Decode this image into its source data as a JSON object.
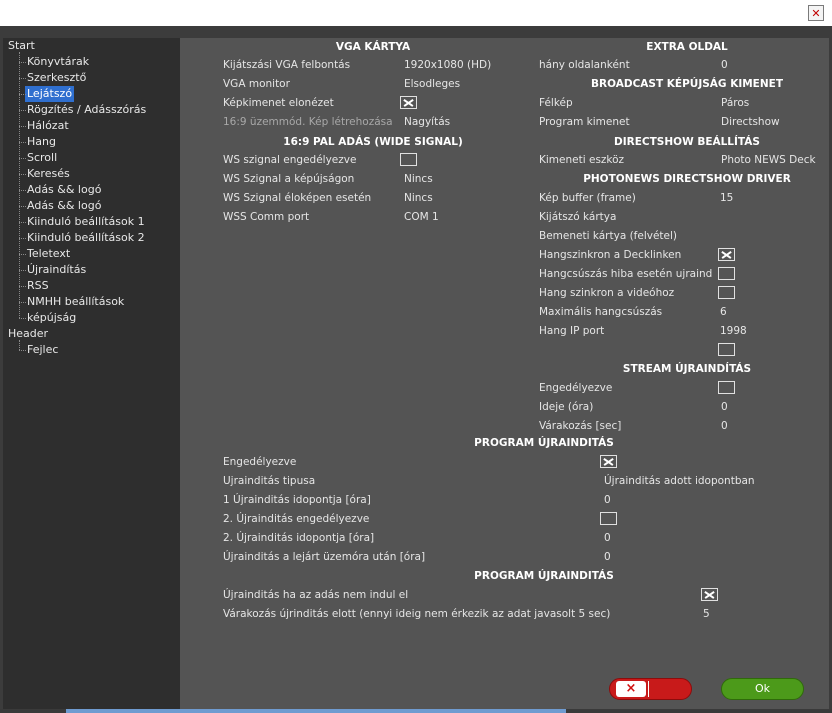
{
  "window": {
    "close_icon": "close-icon"
  },
  "tree": [
    {
      "label": "Start",
      "level": 0
    },
    {
      "label": "Könyvtárak",
      "level": 1
    },
    {
      "label": "Szerkesztő",
      "level": 1
    },
    {
      "label": "Lejátszó",
      "level": 1,
      "selected": true
    },
    {
      "label": "Rögzítés / Adásszórás",
      "level": 1
    },
    {
      "label": "Hálózat",
      "level": 1
    },
    {
      "label": "Hang",
      "level": 1
    },
    {
      "label": "Scroll",
      "level": 1
    },
    {
      "label": "Keresés",
      "level": 1
    },
    {
      "label": "Adás && logó",
      "level": 1
    },
    {
      "label": "Adás && logó",
      "level": 1
    },
    {
      "label": "Kiinduló beállítások 1",
      "level": 1
    },
    {
      "label": "Kiinduló beállítások 2",
      "level": 1
    },
    {
      "label": "Teletext",
      "level": 1
    },
    {
      "label": "Újraindítás",
      "level": 1
    },
    {
      "label": "RSS",
      "level": 1
    },
    {
      "label": "NMHH beállítások",
      "level": 1
    },
    {
      "label": "képújság",
      "level": 1
    },
    {
      "label": "Header",
      "level": 0
    },
    {
      "label": "Fejlec",
      "level": 1
    }
  ],
  "vga": {
    "header": "VGA KÁRTYA",
    "rows": [
      {
        "label": "Kijátszási VGA felbontás",
        "value": "1920x1080 (HD)"
      },
      {
        "label": "VGA monitor",
        "value": "Elsodleges"
      },
      {
        "label": "Képkimenet elonézet",
        "checked": true
      },
      {
        "label": "16:9 üzemmód. Kép létrehozása",
        "value": "Nagyítás",
        "dim": true
      }
    ]
  },
  "pal": {
    "header": "16:9 PAL ADÁS (WIDE SIGNAL)",
    "rows": [
      {
        "label": "WS szignal engedélyezve",
        "checked": false
      },
      {
        "label": "WS Szignal a képújságon",
        "value": "Nincs"
      },
      {
        "label": "WS Szignal éloképen esetén",
        "value": "Nincs"
      },
      {
        "label": "WSS Comm port",
        "value": "COM 1"
      }
    ]
  },
  "extra": {
    "header": "EXTRA OLDAL",
    "rows": [
      {
        "label": "hány oldalanként",
        "value": "0"
      }
    ]
  },
  "broadcast": {
    "header": "BROADCAST KÉPÚJSÁG KIMENET",
    "rows": [
      {
        "label": "Félkép",
        "value": "Páros"
      },
      {
        "label": "Program kimenet",
        "value": "Directshow"
      }
    ]
  },
  "directshow": {
    "header": "DIRECTSHOW BEÁLLÍTÁS",
    "rows": [
      {
        "label": "Kimeneti eszköz",
        "value": "Photo NEWS Deck"
      }
    ]
  },
  "photonews": {
    "header": "PHOTONEWS DIRECTSHOW DRIVER",
    "rows": [
      {
        "label": "Kép buffer (frame)",
        "value": "15"
      },
      {
        "label": "Kijátszó kártya",
        "value": ""
      },
      {
        "label": "Bemeneti kártya (felvétel)",
        "value": ""
      },
      {
        "label": "Hangszinkron a Decklinken",
        "checked": true
      },
      {
        "label": "Hangcsúszás hiba esetén ujraindítás",
        "checked": false
      },
      {
        "label": "Hang szinkron a videóhoz",
        "checked": false
      },
      {
        "label": "Maximális hangcsúszás",
        "value": "6"
      },
      {
        "label": "Hang IP port",
        "value": "1998"
      },
      {
        "label": "",
        "checked": false
      }
    ]
  },
  "stream": {
    "header": "STREAM ÚJRAINDÍTÁS",
    "rows": [
      {
        "label": "Engedélyezve",
        "checked": false
      },
      {
        "label": "Ideje (óra)",
        "value": "0"
      },
      {
        "label": "Várakozás [sec]",
        "value": "0"
      }
    ]
  },
  "program1": {
    "header": "PROGRAM ÚJRAINDITÁS",
    "rows": [
      {
        "label": "Engedélyezve",
        "checked": true
      },
      {
        "label": "Ujrainditás tipusa",
        "value": "Újrainditás adott idopontban"
      },
      {
        "label": "1 Újrainditás idopontja [óra]",
        "value": "0"
      },
      {
        "label": "2. Újrainditás engedélyezve",
        "checked": false
      },
      {
        "label": "2. Újrainditás idopontja [óra]",
        "value": "0"
      },
      {
        "label": "Újrainditás a lejárt üzemóra után [óra]",
        "value": "0"
      }
    ]
  },
  "program2": {
    "header": "PROGRAM ÚJRAINDITÁS",
    "rows": [
      {
        "label": "Újrainditás ha az adás nem indul el",
        "checked": true
      },
      {
        "label": "Várakozás újrinditás elott (ennyi ideig nem érkezik az adat  javasolt 5 sec)",
        "value": "5"
      }
    ]
  },
  "buttons": {
    "cancel": "",
    "cancel_icon": "×",
    "ok": "Ok"
  },
  "colors": {
    "selected": "#2f6fcf",
    "ok": "#4c9a1a",
    "cancel": "#c81a1a"
  }
}
